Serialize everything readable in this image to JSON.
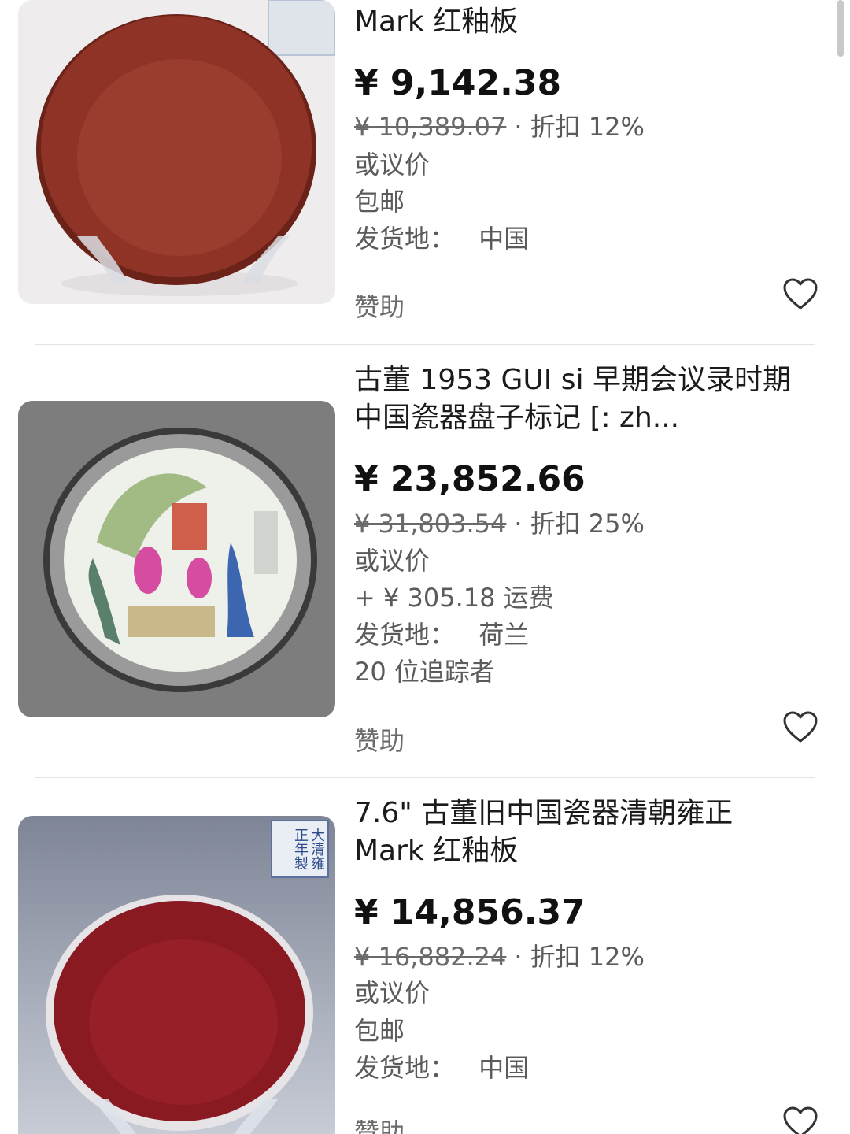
{
  "items": [
    {
      "title_line1": "Mark 红釉板",
      "price": "¥ 9,142.38",
      "original_price": "¥ 10,389.07",
      "discount": "折扣 12%",
      "negotiable": "或议价",
      "shipping": "包邮",
      "location_label": "发货地：",
      "location": "中国",
      "sponsored": "赞助"
    },
    {
      "title_line1": "古董 1953 GUI si 早期会议录时期",
      "title_line2": "中国瓷器盘子标记 [: zh...",
      "price": "¥ 23,852.66",
      "original_price": "¥ 31,803.54",
      "discount": "折扣 25%",
      "negotiable": "或议价",
      "shipping": "+ ¥ 305.18 运费",
      "location_label": "发货地：",
      "location": "荷兰",
      "watchers": "20 位追踪者",
      "sponsored": "赞助"
    },
    {
      "title_line1": "7.6\" 古董旧中国瓷器清朝雍正",
      "title_line2": "Mark 红釉板",
      "price": "¥ 14,856.37",
      "original_price": "¥ 16,882.24",
      "discount": "折扣 12%",
      "negotiable": "或议价",
      "shipping": "包邮",
      "location_label": "发货地：",
      "location": "中国",
      "sponsored": "赞助",
      "seal_text": "大清雍正年製"
    }
  ],
  "icons": {
    "favorite": "heart-outline-icon"
  },
  "colors": {
    "plate_red_1": "#8e3326",
    "plate_red_3": "#8a1a22",
    "price": "#111111",
    "muted": "#5b5b5b"
  }
}
